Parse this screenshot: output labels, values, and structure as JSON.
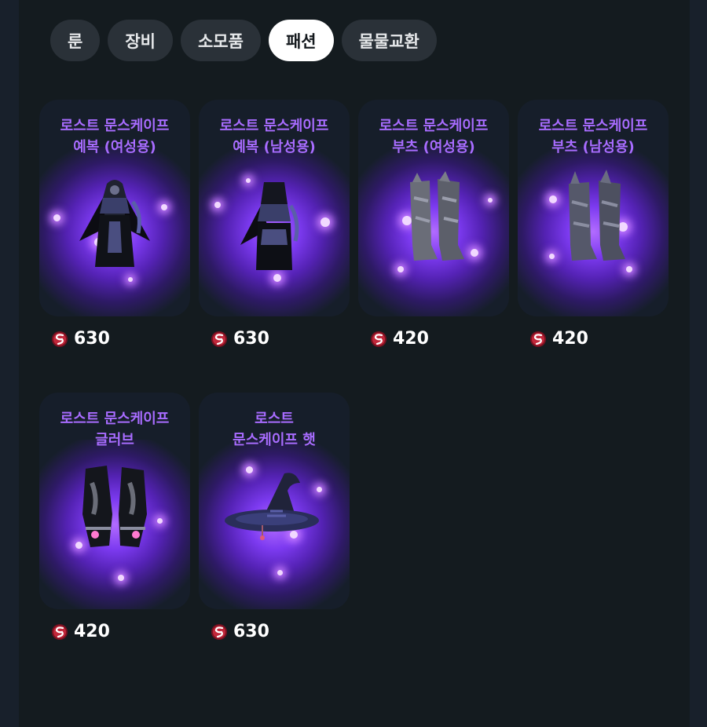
{
  "tabs": [
    {
      "label": "룬",
      "active": false
    },
    {
      "label": "장비",
      "active": false
    },
    {
      "label": "소모품",
      "active": false
    },
    {
      "label": "패션",
      "active": true
    },
    {
      "label": "물물교환",
      "active": false
    }
  ],
  "currency_icon": "ruby-gem-icon",
  "colors": {
    "title": "#a86cff",
    "glow": "#7c3af0",
    "active_tab": "#ffffff"
  },
  "items": [
    {
      "name": "로스트 문스케이프\n예복 (여성용)",
      "price": "630",
      "icon": "robe-icon"
    },
    {
      "name": "로스트 문스케이프\n예복 (남성용)",
      "price": "630",
      "icon": "robe-icon"
    },
    {
      "name": "로스트 문스케이프\n부츠 (여성용)",
      "price": "420",
      "icon": "boots-icon"
    },
    {
      "name": "로스트 문스케이프\n부츠 (남성용)",
      "price": "420",
      "icon": "boots-icon"
    },
    {
      "name": "로스트 문스케이프\n글러브",
      "price": "420",
      "icon": "gloves-icon"
    },
    {
      "name": "로스트\n문스케이프 햇",
      "price": "630",
      "icon": "witch-hat-icon"
    }
  ]
}
